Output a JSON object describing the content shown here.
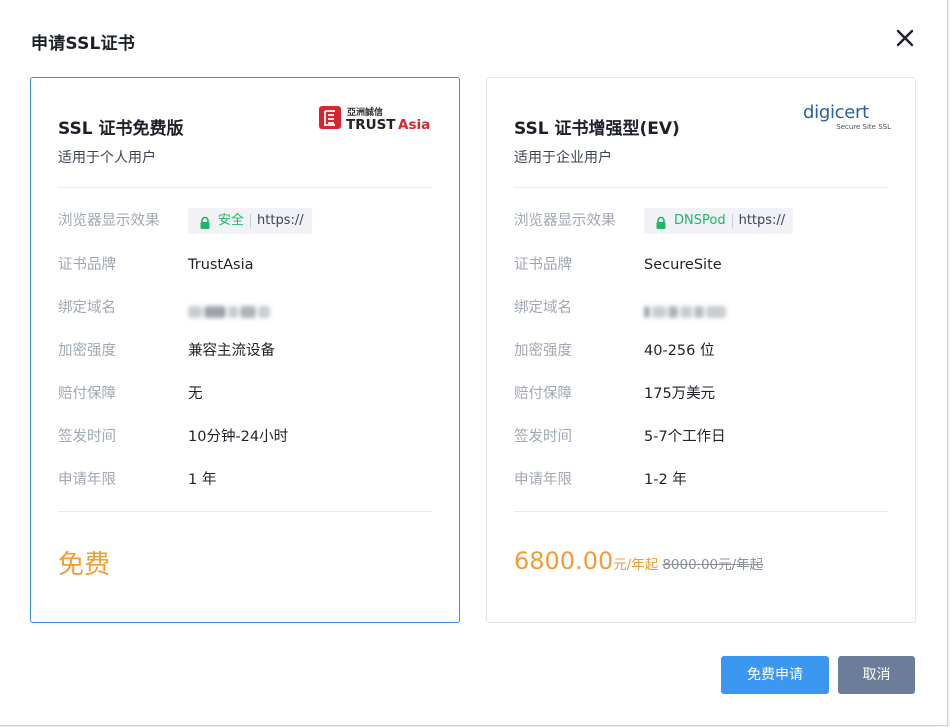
{
  "dialog": {
    "title": "申请SSL证书",
    "close_icon": "close-icon"
  },
  "row_labels": {
    "browser": "浏览器显示效果",
    "brand": "证书品牌",
    "domain": "绑定域名",
    "encryption": "加密强度",
    "warranty": "赔付保障",
    "issue_time": "签发时间",
    "years": "申请年限"
  },
  "cards": {
    "free": {
      "name": "SSL 证书免费版",
      "subtitle": "适用于个人用户",
      "logo_text": "TRUSTAsia",
      "browser_badge": "安全",
      "browser_protocol": "https://",
      "brand": "TrustAsia",
      "encryption": "兼容主流设备",
      "warranty": "无",
      "issue_time": "10分钟-24小时",
      "years": "1 年",
      "price": "免费",
      "accent": "#3a8ee6"
    },
    "ev": {
      "name": "SSL 证书增强型(EV)",
      "subtitle": "适用于企业用户",
      "logo_text": "digicert",
      "logo_subtext": "Secure Site SSL",
      "browser_badge": "DNSPod",
      "browser_protocol": "https://",
      "brand": "SecureSite",
      "encryption": "40-256 位",
      "warranty": "175万美元",
      "issue_time": "5-7个工作日",
      "years": "1-2 年",
      "price_amount": "6800.00",
      "price_unit": "元/年起",
      "price_original": "8000.00元/年起"
    }
  },
  "footer": {
    "apply_label": "免费申请",
    "cancel_label": "取消"
  },
  "colors": {
    "price": "#f29c38",
    "primary_button": "#3c97f0",
    "cancel_button": "#6b7d99",
    "secure_green": "#1fb668"
  }
}
